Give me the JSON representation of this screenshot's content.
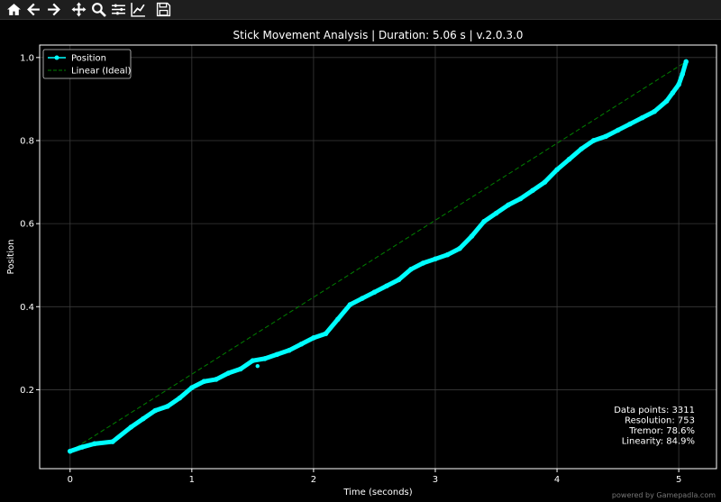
{
  "toolbar": {
    "buttons": [
      {
        "name": "home-icon"
      },
      {
        "name": "back-icon"
      },
      {
        "name": "forward-icon"
      },
      {
        "name": "pan-icon"
      },
      {
        "name": "zoom-icon"
      },
      {
        "name": "configure-subplots-icon"
      },
      {
        "name": "edit-axis-icon"
      },
      {
        "name": "save-icon"
      }
    ]
  },
  "footer": {
    "note": "powered by Gamepadla.com"
  },
  "colors": {
    "background": "#000000",
    "series": "#00ffff",
    "ideal": "#008000",
    "grid": "#3a3a3a"
  },
  "chart_data": {
    "type": "line",
    "title": "Stick Movement Analysis | Duration: 5.06 s | v.2.0.3.0",
    "xlabel": "Time (seconds)",
    "ylabel": "Position",
    "xlim": [
      -0.25,
      5.31
    ],
    "ylim": [
      0.01,
      1.03
    ],
    "xticks": [
      0,
      1,
      2,
      3,
      4,
      5
    ],
    "xtick_labels": [
      "0",
      "1",
      "2",
      "3",
      "4",
      "5"
    ],
    "yticks": [
      0.2,
      0.4,
      0.6,
      0.8,
      1.0
    ],
    "ytick_labels": [
      "0.2",
      "0.4",
      "0.6",
      "0.8",
      "1.0"
    ],
    "grid": true,
    "legend_position": "top-left",
    "series": [
      {
        "name": "Position",
        "style": "line-markers",
        "x": [
          0,
          0.1,
          0.2,
          0.35,
          0.5,
          0.6,
          0.7,
          0.8,
          0.9,
          1.0,
          1.1,
          1.2,
          1.3,
          1.4,
          1.5,
          1.6,
          1.7,
          1.8,
          1.9,
          2.0,
          2.1,
          2.2,
          2.3,
          2.4,
          2.5,
          2.6,
          2.7,
          2.8,
          2.9,
          3.0,
          3.1,
          3.2,
          3.3,
          3.4,
          3.5,
          3.6,
          3.7,
          3.8,
          3.9,
          4.0,
          4.1,
          4.2,
          4.3,
          4.4,
          4.5,
          4.6,
          4.7,
          4.8,
          4.9,
          4.95,
          5.0,
          5.03,
          5.06
        ],
        "y": [
          0.052,
          0.062,
          0.07,
          0.075,
          0.11,
          0.13,
          0.15,
          0.16,
          0.18,
          0.205,
          0.22,
          0.225,
          0.24,
          0.25,
          0.27,
          0.275,
          0.285,
          0.295,
          0.31,
          0.325,
          0.335,
          0.37,
          0.405,
          0.42,
          0.435,
          0.45,
          0.465,
          0.49,
          0.505,
          0.515,
          0.525,
          0.54,
          0.57,
          0.605,
          0.625,
          0.645,
          0.66,
          0.68,
          0.7,
          0.73,
          0.755,
          0.78,
          0.8,
          0.81,
          0.825,
          0.84,
          0.855,
          0.87,
          0.895,
          0.915,
          0.935,
          0.96,
          0.99
        ]
      },
      {
        "name": "Linear (Ideal)",
        "style": "dashed",
        "x": [
          0,
          5.06
        ],
        "y": [
          0.052,
          0.99
        ]
      }
    ],
    "outliers": [
      {
        "x": 1.54,
        "y": 0.257
      }
    ],
    "stats": [
      "Data points: 3311",
      "Resolution: 753",
      "Tremor: 78.6%",
      "Linearity: 84.9%"
    ]
  }
}
